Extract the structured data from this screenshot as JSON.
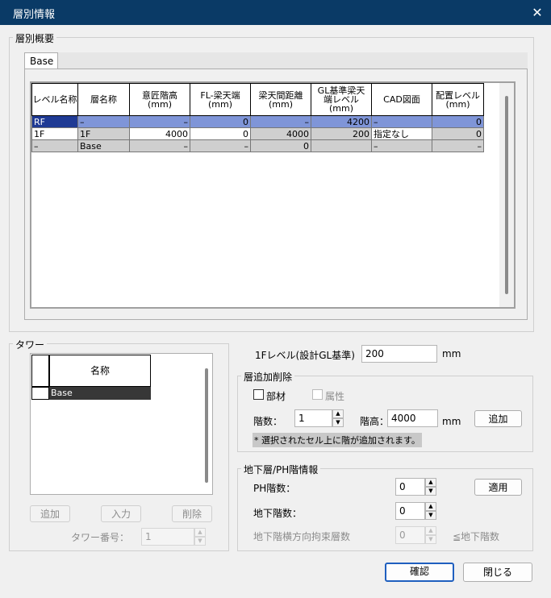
{
  "window": {
    "title": "層別情報",
    "close_glyph": "✕"
  },
  "summary": {
    "group_label": "層別概要",
    "tab": "Base",
    "headers": [
      "レベル名称",
      "層名称",
      "意匠階高\n(mm)",
      "FL-梁天端\n(mm)",
      "梁天間距離\n(mm)",
      "GL基準梁天\n端レベル\n(mm)",
      "CAD図面",
      "配置レベル\n(mm)"
    ],
    "rows": [
      [
        "RF",
        "–",
        "–",
        "0",
        "–",
        "4200",
        "–",
        "0"
      ],
      [
        "1F",
        "1F",
        "4000",
        "0",
        "4000",
        "200",
        "指定なし",
        "0"
      ],
      [
        "–",
        "Base",
        "–",
        "–",
        "0",
        "",
        "–",
        "–"
      ]
    ]
  },
  "tower": {
    "group_label": "タワー",
    "header": "名称",
    "items": [
      "Base"
    ],
    "add_label": "追加",
    "input_label": "入力",
    "delete_label": "削除",
    "number_label": "タワー番号：",
    "number_value": "1"
  },
  "level": {
    "label": "1Fレベル(設計GL基準)",
    "value": "200",
    "unit": "mm"
  },
  "floor_add": {
    "group_label": "層追加削除",
    "member_label": "部材",
    "attr_label": "属性",
    "count_label": "階数：",
    "count_value": "1",
    "height_label": "階高：",
    "height_value": "4000",
    "height_unit": "mm",
    "add_label": "追加",
    "note": "* 選択されたセル上に階が追加されます。"
  },
  "basement": {
    "group_label": "地下層/PH階情報",
    "ph_label": "PH階数：",
    "ph_value": "0",
    "apply_label": "適用",
    "basement_label": "地下階数：",
    "basement_value": "0",
    "constraint_label": "地下階横方向拘束層数",
    "constraint_value": "0",
    "constraint_suffix": "≦地下階数"
  },
  "footer": {
    "ok_label": "確認",
    "close_label": "閉じる"
  }
}
